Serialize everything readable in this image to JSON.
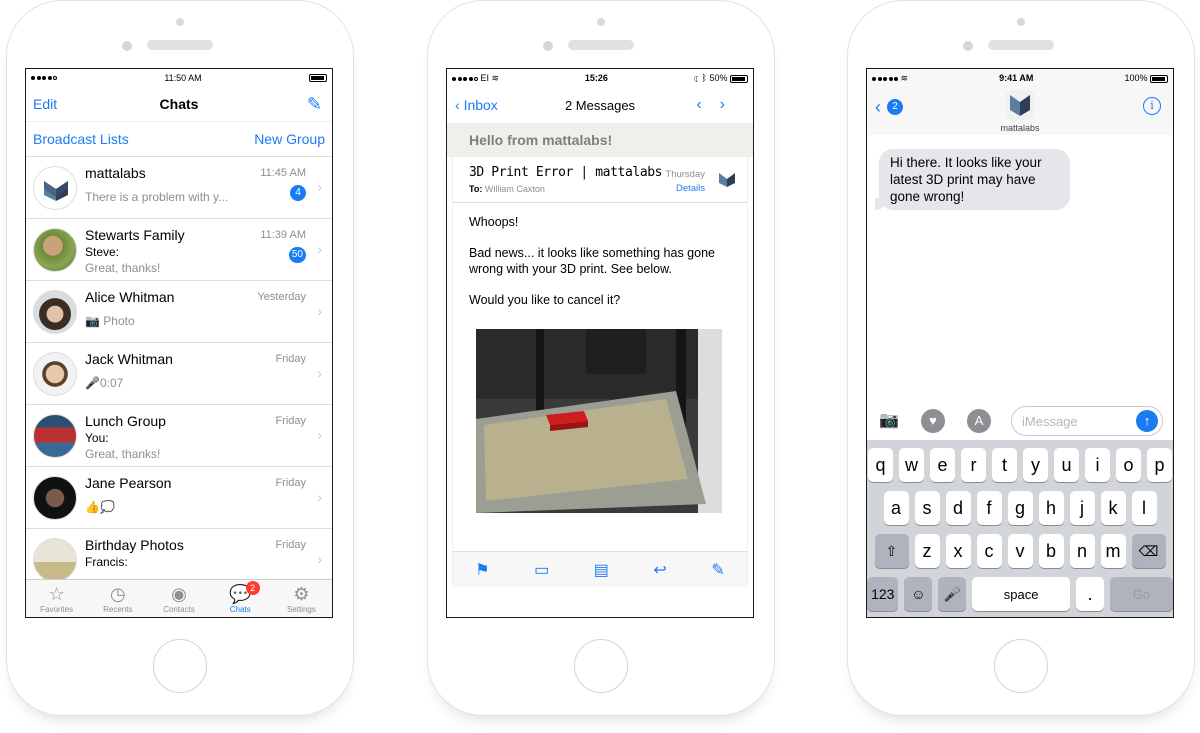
{
  "phone1": {
    "status": {
      "time": "11:50 AM"
    },
    "nav": {
      "edit": "Edit",
      "title": "Chats"
    },
    "broadcast": "Broadcast Lists",
    "new_group": "New Group",
    "chats": [
      {
        "name": "mattalabs",
        "time": "11:45 AM",
        "preview": "There is a problem with y...",
        "badge": "4"
      },
      {
        "name": "Stewarts Family",
        "time": "11:39 AM",
        "sender": "Steve:",
        "preview": "Great, thanks!",
        "badge": "50"
      },
      {
        "name": "Alice Whitman",
        "time": "Yesterday",
        "preview": "Photo"
      },
      {
        "name": "Jack Whitman",
        "time": "Friday",
        "preview": "0:07"
      },
      {
        "name": "Lunch Group",
        "time": "Friday",
        "sender": "You:",
        "preview": "Great, thanks!"
      },
      {
        "name": "Jane Pearson",
        "time": "Friday",
        "preview": "👍💭"
      },
      {
        "name": "Birthday Photos",
        "time": "Friday",
        "sender": "Francis:"
      }
    ],
    "tabs": [
      "Favorites",
      "Recents",
      "Contacts",
      "Chats",
      "Settings"
    ],
    "chats_badge": "2"
  },
  "phone2": {
    "status": {
      "carrier": "EI",
      "time": "15:26",
      "battery": "50%"
    },
    "nav": {
      "back": "Inbox",
      "title": "2 Messages"
    },
    "subject_banner": "Hello from mattalabs!",
    "mail": {
      "title": "3D Print Error | mattalabs",
      "to_label": "To:",
      "to": "William Caxton",
      "day": "Thursday",
      "details": "Details",
      "body": [
        "Whoops!",
        "Bad news... it looks like something has gone wrong with your 3D print. See below.",
        "Would you like to cancel it?"
      ]
    }
  },
  "phone3": {
    "status": {
      "time": "9:41 AM",
      "battery": "100%"
    },
    "nav": {
      "back_badge": "2",
      "name": "mattalabs"
    },
    "bubble": "Hi there. It looks like your latest 3D print may have gone wrong!",
    "input_placeholder": "iMessage",
    "keys": {
      "row1": [
        "q",
        "w",
        "e",
        "r",
        "t",
        "y",
        "u",
        "i",
        "o",
        "p"
      ],
      "row2": [
        "a",
        "s",
        "d",
        "f",
        "g",
        "h",
        "j",
        "k",
        "l"
      ],
      "row3": [
        "z",
        "x",
        "c",
        "v",
        "b",
        "n",
        "m"
      ],
      "num": "123",
      "space": "space",
      "dot": ".",
      "go": "Go"
    }
  },
  "colors": {
    "accent": "#1a7cf5",
    "badge_red": "#ff3b30",
    "logo_dark": "#2f3d56",
    "logo_mid": "#5a7da0"
  }
}
